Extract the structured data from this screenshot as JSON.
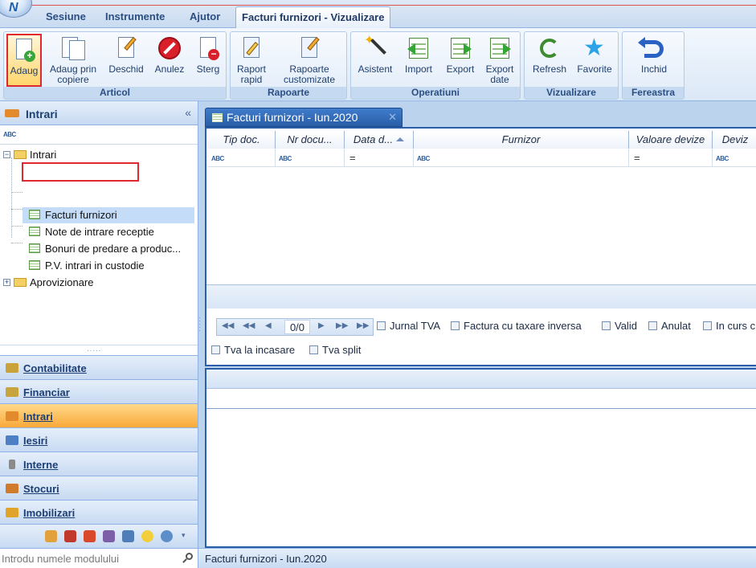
{
  "ribbon_tabs": [
    {
      "label": "Sesiune"
    },
    {
      "label": "Instrumente"
    },
    {
      "label": "Ajutor"
    },
    {
      "label": "Facturi furnizori - Vizualizare"
    }
  ],
  "ribbon_groups": {
    "articol": {
      "label": "Articol",
      "buttons": [
        {
          "label": "Adaug",
          "icon": "add-document-icon"
        },
        {
          "label": "Adaug prin copiere",
          "icon": "copy-document-icon"
        },
        {
          "label": "Deschid",
          "icon": "edit-document-icon"
        },
        {
          "label": "Anulez",
          "icon": "cancel-icon"
        },
        {
          "label": "Sterg",
          "icon": "delete-document-icon"
        }
      ]
    },
    "rapoarte": {
      "label": "Rapoarte",
      "buttons": [
        {
          "label": "Raport rapid",
          "icon": "quick-report-icon"
        },
        {
          "label": "Rapoarte customizate",
          "icon": "custom-reports-icon"
        }
      ]
    },
    "operatiuni": {
      "label": "Operatiuni",
      "buttons": [
        {
          "label": "Asistent",
          "icon": "wizard-icon"
        },
        {
          "label": "Import",
          "icon": "import-icon"
        },
        {
          "label": "Export",
          "icon": "export-icon"
        },
        {
          "label": "Export date",
          "icon": "export-data-icon"
        }
      ]
    },
    "vizualizare": {
      "label": "Vizualizare",
      "buttons": [
        {
          "label": "Refresh",
          "icon": "refresh-icon"
        },
        {
          "label": "Favorite",
          "icon": "star-icon"
        }
      ]
    },
    "fereastra": {
      "label": "Fereastra",
      "buttons": [
        {
          "label": "Inchid",
          "icon": "close-window-icon"
        }
      ]
    }
  },
  "sidebar": {
    "title": "Intrari",
    "filter_token": "ABC",
    "tree": {
      "root": "Intrari",
      "children": [
        "Facturi furnizori",
        "Note de intrare receptie",
        "Bonuri de predare a produc...",
        "P.V. intrari in custodie"
      ],
      "sibling": "Aprovizionare"
    },
    "nav_items": [
      {
        "label": "Contabilitate",
        "icon": "scales-icon",
        "color": "#c9a23a"
      },
      {
        "label": "Financiar",
        "icon": "money-icon",
        "color": "#c8a53c"
      },
      {
        "label": "Intrari",
        "icon": "truck-in-icon",
        "color": "#e28a2c"
      },
      {
        "label": "Iesiri",
        "icon": "truck-out-icon",
        "color": "#4e7fc4"
      },
      {
        "label": "Interne",
        "icon": "paperclip-icon",
        "color": "#8a8a8a"
      },
      {
        "label": "Stocuri",
        "icon": "boxes-icon",
        "color": "#d07a2c"
      },
      {
        "label": "Imobilizari",
        "icon": "drill-icon",
        "color": "#e0a42a"
      }
    ],
    "search_placeholder": "Introdu numele modulului"
  },
  "document": {
    "tab_title": "Facturi furnizori - Iun.2020",
    "columns": [
      "Tip doc.",
      "Nr docu...",
      "Data d...",
      "Furnizor",
      "Valoare devize",
      "Deviz"
    ],
    "filter_tokens": [
      "ABC",
      "ABC",
      "=",
      "ABC",
      "=",
      "ABC"
    ],
    "pager_position": "0/0",
    "checkboxes_row1": [
      "Jurnal TVA",
      "Factura cu taxare inversa",
      "Valid",
      "Anulat",
      "In curs c"
    ],
    "checkboxes_row2": [
      "Tva la incasare",
      "Tva split"
    ]
  },
  "statusbar": {
    "text": "Facturi furnizori - Iun.2020"
  },
  "colors": {
    "accent_blue": "#2a5ea8",
    "highlight_red": "#e0282f",
    "active_nav_orange": "#f9a93a"
  }
}
